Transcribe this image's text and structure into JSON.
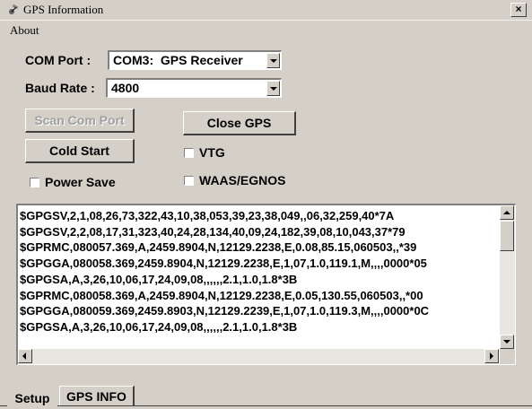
{
  "window": {
    "title": "GPS Information",
    "close_glyph": "×",
    "app_icon": "satellite-icon"
  },
  "menu": {
    "items": [
      {
        "label": "About"
      }
    ]
  },
  "form": {
    "com_port": {
      "label": "COM Port :",
      "value": "COM3:  GPS Receiver"
    },
    "baud_rate": {
      "label": "Baud Rate :",
      "value": "4800"
    }
  },
  "buttons": {
    "scan": "Scan Com Port",
    "close_gps": "Close GPS",
    "cold_start": "Cold Start"
  },
  "checkboxes": {
    "vtg": {
      "label": "VTG",
      "checked": false
    },
    "power_save": {
      "label": "Power Save",
      "checked": false
    },
    "waas": {
      "label": "WAAS/EGNOS",
      "checked": false
    }
  },
  "log": {
    "lines": [
      "$GPGSV,2,1,08,26,73,322,43,10,38,053,39,23,38,049,,06,32,259,40*7A",
      "$GPGSV,2,2,08,17,31,323,40,24,28,134,40,09,24,182,39,08,10,043,37*79",
      "$GPRMC,080057.369,A,2459.8904,N,12129.2238,E,0.08,85.15,060503,,*39",
      "$GPGGA,080058.369,2459.8904,N,12129.2238,E,1,07,1.0,119.1,M,,,,0000*05",
      "$GPGSA,A,3,26,10,06,17,24,09,08,,,,,,2.1,1.0,1.8*3B",
      "$GPRMC,080058.369,A,2459.8904,N,12129.2238,E,0.05,130.55,060503,,*00",
      "$GPGGA,080059.369,2459.8903,N,12129.2239,E,1,07,1.0,119.3,M,,,,0000*0C",
      "$GPGSA,A,3,26,10,06,17,24,09,08,,,,,,2.1,1.0,1.8*3B"
    ]
  },
  "tabs": [
    {
      "label": "Setup",
      "active": true
    },
    {
      "label": "GPS INFO",
      "active": false
    }
  ]
}
